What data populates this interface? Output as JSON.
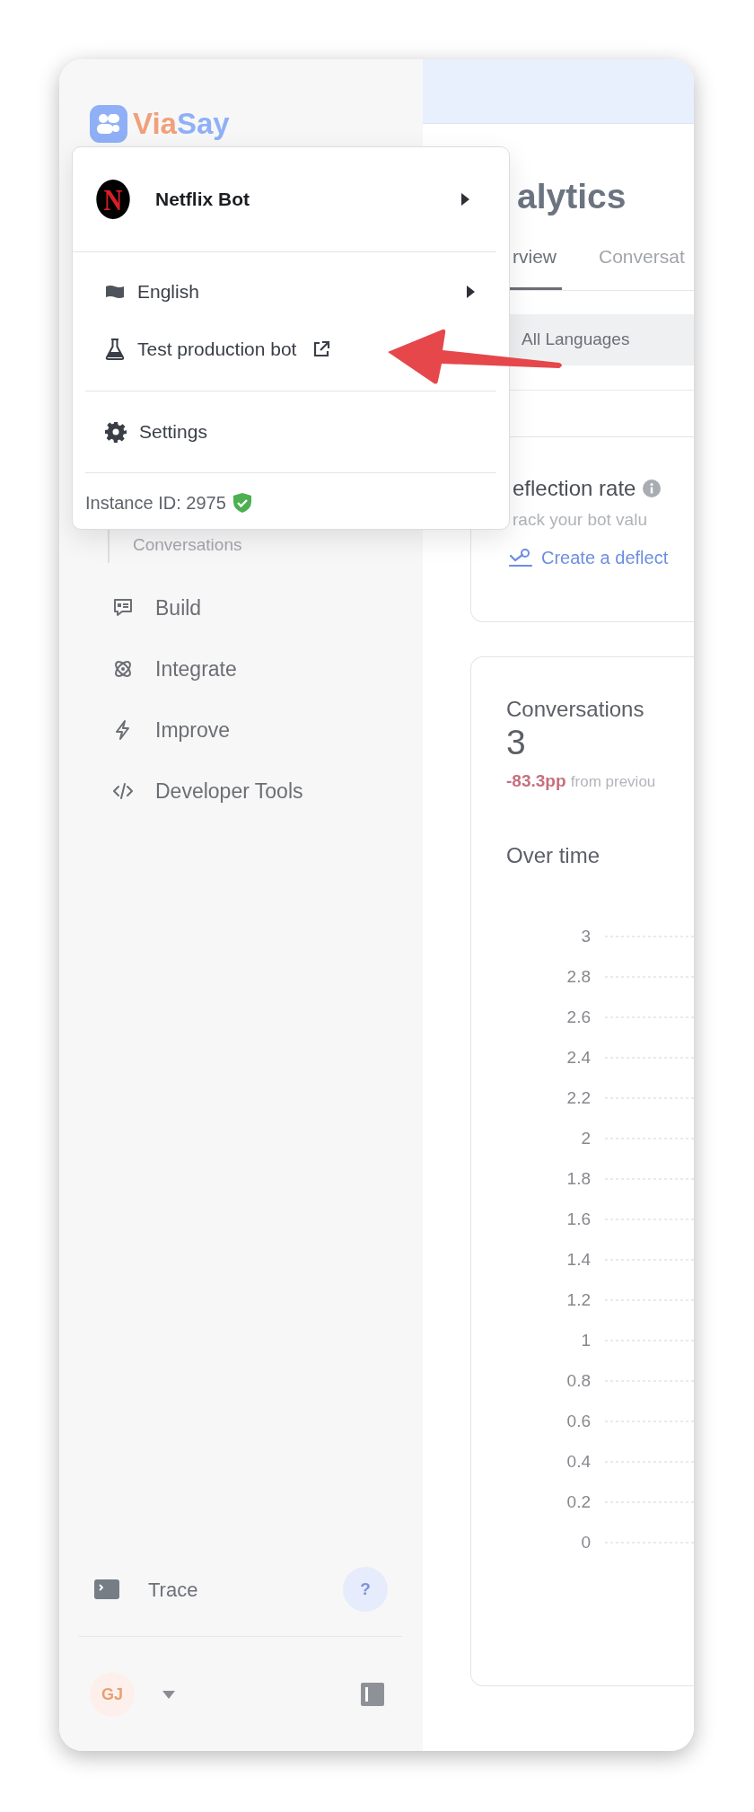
{
  "logo": {
    "first": "Via",
    "second": "Say"
  },
  "bot_menu": {
    "bot": {
      "avatar": "N",
      "name": "Netflix Bot"
    },
    "language": {
      "label": "English"
    },
    "test_bot": {
      "label": "Test production bot"
    },
    "settings": {
      "label": "Settings"
    },
    "instance": {
      "label": "Instance ID: 2975",
      "verified": true
    }
  },
  "sidebar": {
    "sub_items": [
      {
        "label": "Conversations"
      }
    ],
    "items": [
      {
        "kind": "build",
        "label": "Build"
      },
      {
        "kind": "integrate",
        "label": "Integrate"
      },
      {
        "kind": "improve",
        "label": "Improve"
      },
      {
        "kind": "code",
        "label": "Developer Tools"
      }
    ],
    "trace": {
      "label": "Trace"
    },
    "help_button": "?",
    "user": {
      "initials": "GJ"
    }
  },
  "main": {
    "title": "alytics",
    "tabs": [
      {
        "label": "rview",
        "selected": true
      },
      {
        "label": "Conversat",
        "selected": false
      }
    ],
    "language_filter": "All Languages",
    "deflection_card": {
      "title": "eflection rate",
      "description": "rack your bot valu",
      "link": "Create a deflect"
    },
    "conversations_card": {
      "title": "Conversations",
      "value": "3",
      "change": "-83.3pp",
      "change_note": "from previou",
      "chart_title": "Over time",
      "grid_labels": [
        "3",
        "2.8",
        "2.6",
        "2.4",
        "2.2",
        "2",
        "1.8",
        "1.6",
        "1.4",
        "1.2",
        "1",
        "0.8",
        "0.6",
        "0.4",
        "0.2",
        "0"
      ]
    }
  }
}
